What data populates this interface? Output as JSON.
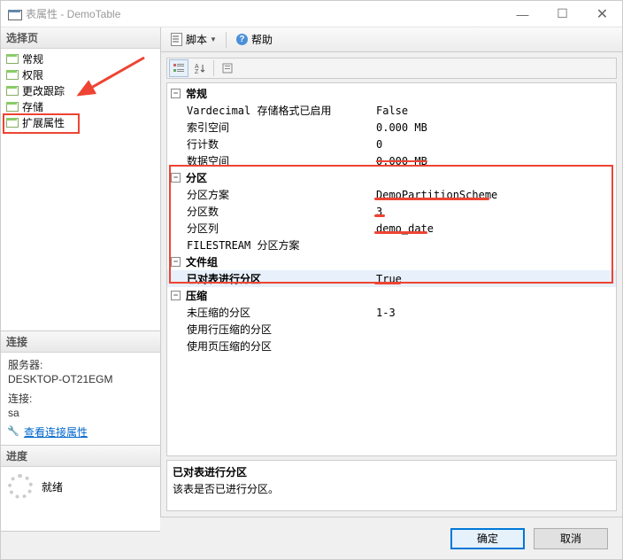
{
  "window": {
    "title": "表属性 - DemoTable",
    "min": "—",
    "max": "☐",
    "close": "✕"
  },
  "sidebar": {
    "select_page": "选择页",
    "items": [
      {
        "label": "常规"
      },
      {
        "label": "权限"
      },
      {
        "label": "更改跟踪"
      },
      {
        "label": "存储"
      },
      {
        "label": "扩展属性"
      }
    ],
    "connection": {
      "header": "连接",
      "server_label": "服务器:",
      "server_value": "DESKTOP-OT21EGM",
      "conn_label": "连接:",
      "conn_value": "sa",
      "view_props": "查看连接属性"
    },
    "progress": {
      "header": "进度",
      "status": "就绪"
    }
  },
  "toolbar": {
    "script": "脚本",
    "help": "帮助"
  },
  "grid": {
    "cat1": "常规",
    "p_vardecimal_k": "Vardecimal 存储格式已启用",
    "p_vardecimal_v": "False",
    "p_indexspace_k": "索引空间",
    "p_indexspace_v": "0.000 MB",
    "p_rowcount_k": "行计数",
    "p_rowcount_v": "0",
    "p_dataspace_k": "数据空间",
    "p_dataspace_v": "0.000 MB",
    "cat2": "分区",
    "p_scheme_k": "分区方案",
    "p_scheme_v": "DemoPartitionScheme",
    "p_partcount_k": "分区数",
    "p_partcount_v": "3",
    "p_partcol_k": "分区列",
    "p_partcol_v": "demo_date",
    "p_fstream_k": "FILESTREAM 分区方案",
    "p_fstream_v": "",
    "cat3": "文件组",
    "p_ispart_k": "已对表进行分区",
    "p_ispart_v": "True",
    "cat4": "压缩",
    "p_uncomp_k": "未压缩的分区",
    "p_uncomp_v": "1-3",
    "p_rowcomp_k": "使用行压缩的分区",
    "p_rowcomp_v": "",
    "p_pagecomp_k": "使用页压缩的分区",
    "p_pagecomp_v": ""
  },
  "desc": {
    "title": "已对表进行分区",
    "body": "该表是否已进行分区。"
  },
  "buttons": {
    "ok": "确定",
    "cancel": "取消"
  }
}
